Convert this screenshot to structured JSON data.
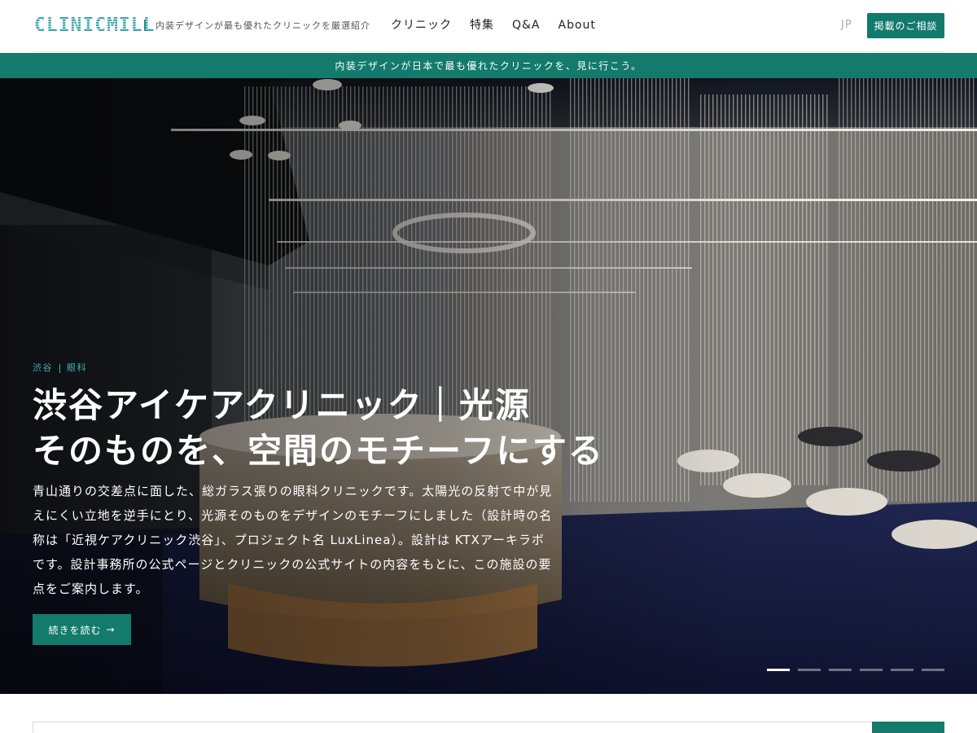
{
  "header": {
    "logo": "CLINICMILL",
    "tagline": "内装デザインが最も優れたクリニックを厳選紹介",
    "nav": [
      {
        "label": "クリニック"
      },
      {
        "label": "特集"
      },
      {
        "label": "Q&A"
      },
      {
        "label": "About"
      }
    ],
    "language": "JP",
    "contact_label": "掲載のご相談"
  },
  "banner": {
    "text": "内装デザインが日本で最も優れたクリニックを、見に行こう。"
  },
  "hero": {
    "category_area": "渋谷",
    "category_type": "眼科",
    "title_line1": "渋谷アイケアクリニック｜光源",
    "title_line2": "そのものを、空間のモチーフにする",
    "description": "青山通りの交差点に面した、総ガラス張りの眼科クリニックです。太陽光の反射で中が見えにくい立地を逆手にとり、光源そのものをデザインのモチーフにしました（設計時の名称は「近視ケアクリニック渋谷」、プロジェクト名 LuxLinea）。設計は KTXアーキラボです。設計事務所の公式ページとクリニックの公式サイトの内容をもとに、この施設の要点をご案内します。",
    "read_more_label": "続きを読む",
    "read_more_arrow": "→",
    "slides_total": 6,
    "slide_active": 1
  },
  "colors": {
    "accent": "#137a6c",
    "category": "#3fb3b4"
  }
}
